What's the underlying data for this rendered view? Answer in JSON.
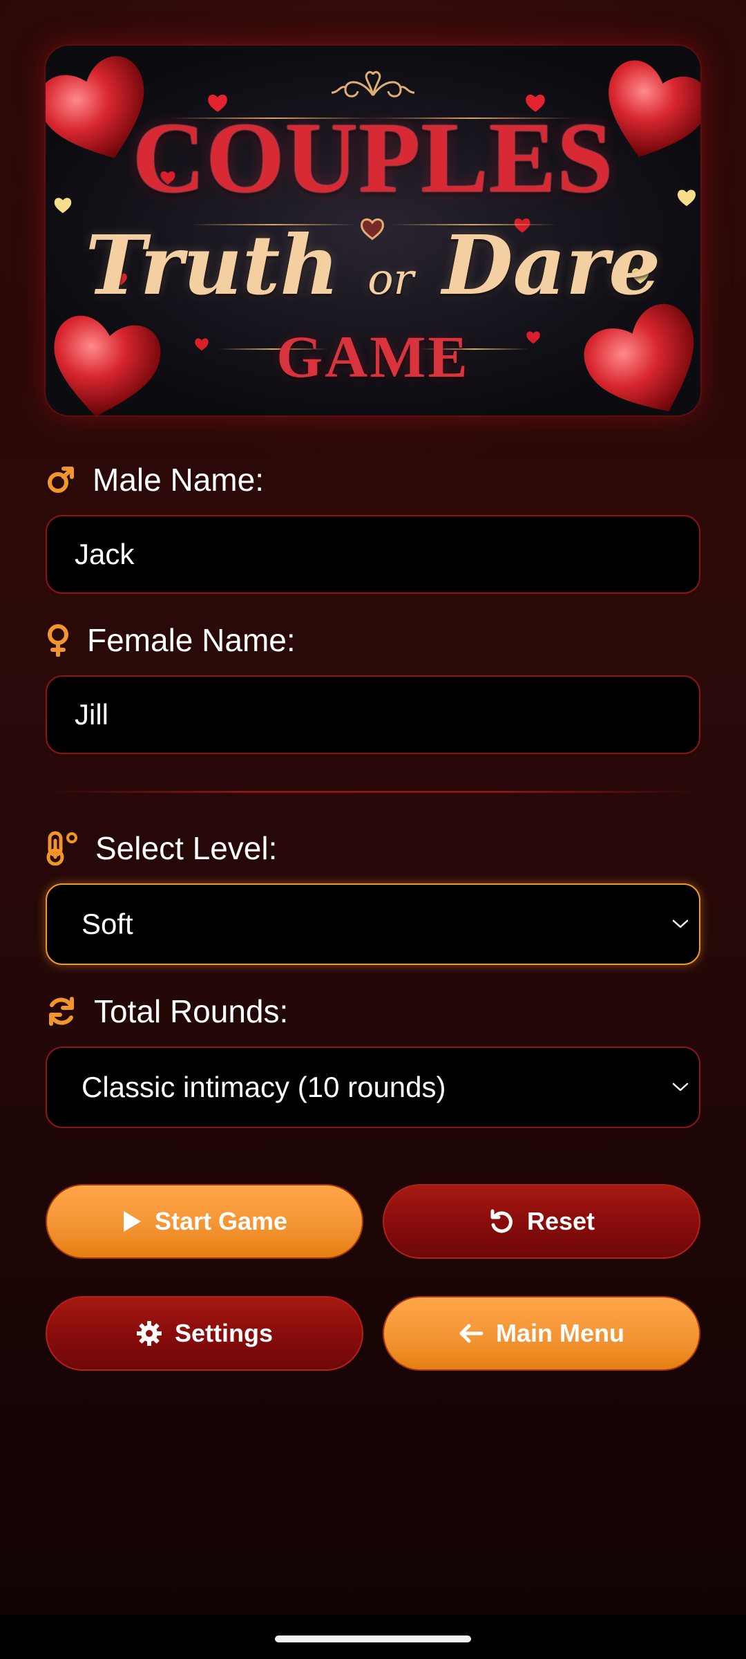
{
  "banner": {
    "title_line1": "COUPLES",
    "title_line2_a": "Truth",
    "title_line2_or": "or",
    "title_line2_b": "Dare",
    "title_line3": "GAME"
  },
  "form": {
    "male_label": "Male Name:",
    "male_value": "Jack",
    "female_label": "Female Name:",
    "female_value": "Jill",
    "level_label": "Select Level:",
    "level_value": "Soft",
    "rounds_label": "Total Rounds:",
    "rounds_value": "Classic intimacy (10 rounds)"
  },
  "buttons": {
    "start": "Start Game",
    "reset": "Reset",
    "settings": "Settings",
    "main_menu": "Main Menu"
  },
  "colors": {
    "accent_orange": "#f49534",
    "accent_red": "#8a0c0c",
    "field_border": "#8f1515",
    "background": "#2a0707"
  },
  "icons": {
    "male": "male-icon",
    "female": "female-icon",
    "level": "thermometer-icon",
    "rounds": "refresh-icon",
    "start": "play-icon",
    "reset": "undo-icon",
    "settings": "gear-icon",
    "main_menu": "arrow-left-icon"
  }
}
